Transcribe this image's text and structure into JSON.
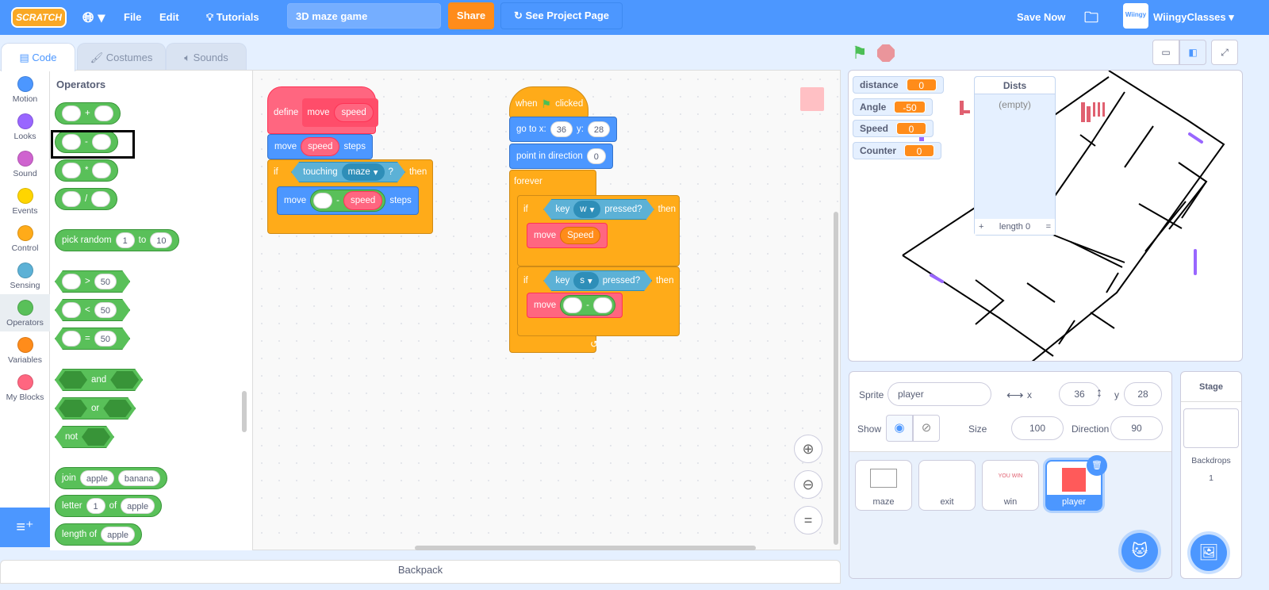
{
  "menu": {
    "logo": "SCRATCH",
    "file": "File",
    "edit": "Edit",
    "tutorials": "Tutorials",
    "project_title": "3D maze game",
    "share": "Share",
    "see_project": "See Project Page",
    "save_now": "Save Now",
    "username": "WiingyClasses",
    "avatar_text": "Wiingy"
  },
  "tabs": [
    {
      "label": "Code"
    },
    {
      "label": "Costumes"
    },
    {
      "label": "Sounds"
    }
  ],
  "categories": [
    {
      "label": "Motion",
      "color": "#4c97ff"
    },
    {
      "label": "Looks",
      "color": "#9966ff"
    },
    {
      "label": "Sound",
      "color": "#cf63cf"
    },
    {
      "label": "Events",
      "color": "#ffd500"
    },
    {
      "label": "Control",
      "color": "#ffab19"
    },
    {
      "label": "Sensing",
      "color": "#5cb1d6"
    },
    {
      "label": "Operators",
      "color": "#59c059"
    },
    {
      "label": "Variables",
      "color": "#ff8c1a"
    },
    {
      "label": "My Blocks",
      "color": "#ff6680"
    }
  ],
  "palette": {
    "heading": "Operators",
    "add": "+",
    "sub": "-",
    "mul": "*",
    "div": "/",
    "pick_random": "pick random",
    "pr_from": "1",
    "pr_to_label": "to",
    "pr_to": "10",
    "gt": ">",
    "lt": "<",
    "eq": "=",
    "cmp_val": "50",
    "and": "and",
    "or": "or",
    "not": "not",
    "join": "join",
    "join_a": "apple",
    "join_b": "banana",
    "letter": "letter",
    "letter_n": "1",
    "of": "of",
    "letter_s": "apple",
    "length_of": "length of",
    "length_s": "apple"
  },
  "scripts": {
    "define": "define",
    "move": "move",
    "speed": "speed",
    "steps": "steps",
    "if": "if",
    "touching": "touching",
    "maze": "maze",
    "q": "?",
    "then": "then",
    "minus": "-",
    "when": "when",
    "clicked": "clicked",
    "goto_x": "go to x:",
    "x": "36",
    "y_label": "y:",
    "y": "28",
    "point_dir": "point in direction",
    "dir": "0",
    "forever": "forever",
    "key": "key",
    "w": "w",
    "s": "s",
    "pressed": "pressed?",
    "Speed": "Speed"
  },
  "stage": {
    "monitors": [
      {
        "name": "distance",
        "value": "0"
      },
      {
        "name": "Angle",
        "value": "-50"
      },
      {
        "name": "Speed",
        "value": "0"
      },
      {
        "name": "Counter",
        "value": "0"
      }
    ],
    "list": {
      "title": "Dists",
      "empty": "(empty)",
      "add": "+",
      "length": "length 0",
      "resize": "="
    }
  },
  "sprite_info": {
    "sprite_label": "Sprite",
    "sprite_name": "player",
    "x_label": "x",
    "x": "36",
    "y_label": "y",
    "y": "28",
    "show_label": "Show",
    "size_label": "Size",
    "size": "100",
    "direction_label": "Direction",
    "direction": "90"
  },
  "sprites": [
    {
      "name": "maze"
    },
    {
      "name": "exit"
    },
    {
      "name": "win"
    },
    {
      "name": "player",
      "selected": true
    }
  ],
  "stage_panel": {
    "title": "Stage",
    "backdrops_label": "Backdrops",
    "backdrops": "1"
  },
  "backpack": "Backpack"
}
